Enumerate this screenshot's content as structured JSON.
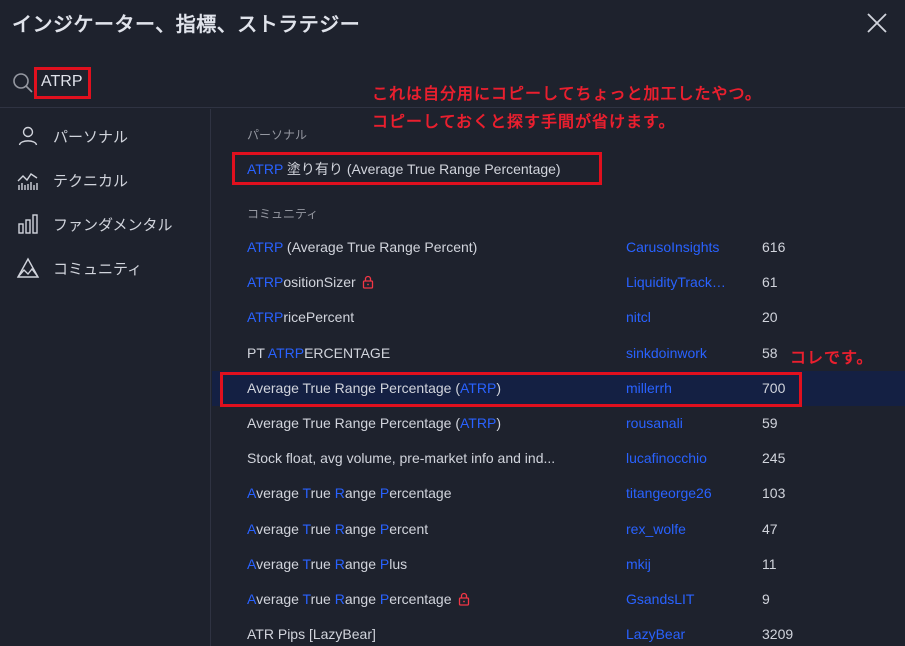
{
  "header": {
    "title": "インジケーター、指標、ストラテジー"
  },
  "search": {
    "value": "ATRP"
  },
  "annotations": {
    "note_line1": "これは自分用にコピーしてちょっと加工したやつ。",
    "note_line2": "コピーしておくと探す手間が省けます。",
    "this_one": "コレです。"
  },
  "sidebar": {
    "items": [
      {
        "label": "パーソナル",
        "icon": "user-icon"
      },
      {
        "label": "テクニカル",
        "icon": "chart-line-icon"
      },
      {
        "label": "ファンダメンタル",
        "icon": "bar-chart-icon"
      },
      {
        "label": "コミュニティ",
        "icon": "community-icon"
      }
    ]
  },
  "sections": {
    "personal": "パーソナル",
    "community": "コミュニティ"
  },
  "personal_script": {
    "hl": "ATRP",
    "rest": " 塗り有り (Average True Range Percentage)"
  },
  "community_scripts": [
    {
      "pre": "",
      "hl": "ATRP",
      "post": " (Average True Range Percent)",
      "author": "CarusoInsights",
      "count": "616"
    },
    {
      "pre": "",
      "hl": "ATRP",
      "post": "ositionSizer",
      "locked": true,
      "author": "LiquidityTrack…",
      "count": "61"
    },
    {
      "pre": "",
      "hl": "ATRP",
      "post": "ricePercent",
      "author": "nitcl",
      "count": "20"
    },
    {
      "pre": "PT ",
      "hl": "ATRP",
      "post": "ERCENTAGE",
      "author": "sinkdoinwork",
      "count": "58"
    },
    {
      "pre": "Average True Range Percentage (",
      "hl": "ATRP",
      "post": ")",
      "author": "millerrh",
      "count": "700",
      "selected": true
    },
    {
      "pre": "Average True Range Percentage (",
      "hl": "ATRP",
      "post": ")",
      "author": "rousanali",
      "count": "59"
    },
    {
      "pre": "Stock float, avg volume, pre-market info and ind...",
      "hl": "",
      "post": "",
      "author": "lucafinocchio",
      "count": "245"
    },
    {
      "segments": [
        [
          "A",
          "h"
        ],
        [
          "verage ",
          ""
        ],
        [
          "T",
          "h"
        ],
        [
          "rue ",
          ""
        ],
        [
          "R",
          "h"
        ],
        [
          "ange ",
          ""
        ],
        [
          "P",
          "h"
        ],
        [
          "ercentage",
          ""
        ]
      ],
      "author": "titangeorge26",
      "count": "103"
    },
    {
      "segments": [
        [
          "A",
          "h"
        ],
        [
          "verage ",
          ""
        ],
        [
          "T",
          "h"
        ],
        [
          "rue ",
          ""
        ],
        [
          "R",
          "h"
        ],
        [
          "ange ",
          ""
        ],
        [
          "P",
          "h"
        ],
        [
          "ercent",
          ""
        ]
      ],
      "author": "rex_wolfe",
      "count": "47"
    },
    {
      "segments": [
        [
          "A",
          "h"
        ],
        [
          "verage ",
          ""
        ],
        [
          "T",
          "h"
        ],
        [
          "rue ",
          ""
        ],
        [
          "R",
          "h"
        ],
        [
          "ange ",
          ""
        ],
        [
          "P",
          "h"
        ],
        [
          "lus",
          ""
        ]
      ],
      "author": "mkij",
      "count": "11"
    },
    {
      "segments": [
        [
          "A",
          "h"
        ],
        [
          "verage ",
          ""
        ],
        [
          "T",
          "h"
        ],
        [
          "rue ",
          ""
        ],
        [
          "R",
          "h"
        ],
        [
          "ange ",
          ""
        ],
        [
          "P",
          "h"
        ],
        [
          "ercentage",
          ""
        ]
      ],
      "locked": true,
      "author": "GsandsLIT",
      "count": "9"
    },
    {
      "pre": "ATR Pips [LazyBear]",
      "hl": "",
      "post": "",
      "author": "LazyBear",
      "count": "3209"
    }
  ]
}
